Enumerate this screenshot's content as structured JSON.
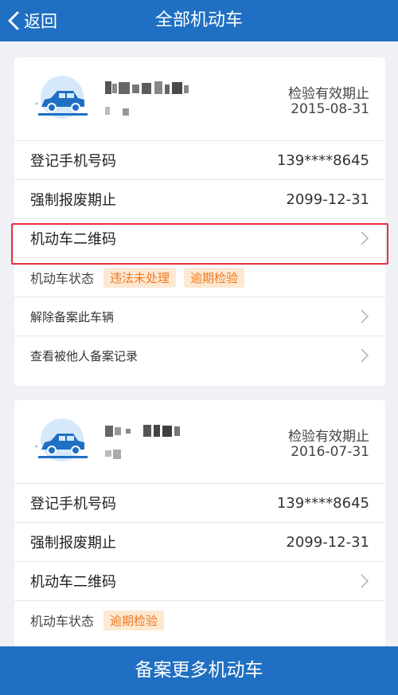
{
  "nav": {
    "back_label": "返回",
    "title": "全部机动车"
  },
  "vehicles": [
    {
      "inspection_label": "检验有效期止",
      "inspection_date": "2015-08-31",
      "rows": {
        "phone_label": "登记手机号码",
        "phone_value": "139****8645",
        "scrap_label": "强制报废期止",
        "scrap_value": "2099-12-31",
        "qr_label": "机动车二维码",
        "status_label": "机动车状态",
        "unbind_label": "解除备案此车辆",
        "records_label": "查看被他人备案记录"
      },
      "badges": [
        "违法未处理",
        "逾期检验"
      ]
    },
    {
      "inspection_label": "检验有效期止",
      "inspection_date": "2016-07-31",
      "rows": {
        "phone_label": "登记手机号码",
        "phone_value": "139****8645",
        "scrap_label": "强制报废期止",
        "scrap_value": "2099-12-31",
        "qr_label": "机动车二维码",
        "status_label": "机动车状态"
      },
      "badges": [
        "逾期检验"
      ]
    }
  ],
  "bottom_button": "备案更多机动车",
  "colors": {
    "brand": "#1f6fc2",
    "badge_text": "#ef7a22",
    "badge_bg": "#fde8d2",
    "highlight": "#e8303a"
  }
}
